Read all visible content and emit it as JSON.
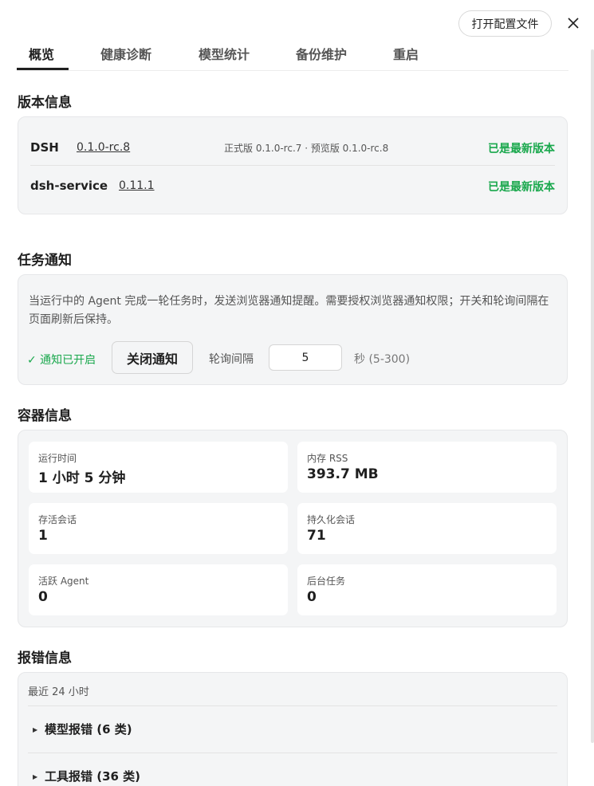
{
  "toolbar": {
    "open_config_label": "打开配置文件",
    "close_icon": "close-icon"
  },
  "tabs": [
    {
      "label": "概览",
      "active": true
    },
    {
      "label": "健康诊断",
      "active": false
    },
    {
      "label": "模型统计",
      "active": false
    },
    {
      "label": "备份维护",
      "active": false
    },
    {
      "label": "重启",
      "active": false
    }
  ],
  "version": {
    "title": "版本信息",
    "rows": [
      {
        "name": "DSH",
        "version": "0.1.0-rc.8",
        "channel": "正式版 0.1.0-rc.7 · 预览版 0.1.0-rc.8",
        "status": "已是最新版本"
      },
      {
        "name": "dsh-service",
        "version": "0.11.1",
        "channel": "",
        "status": "已是最新版本"
      }
    ]
  },
  "notify": {
    "title": "任务通知",
    "description": "当运行中的 Agent 完成一轮任务时，发送浏览器通知提醒。需要授权浏览器通知权限；开关和轮询间隔在页面刷新后保持。",
    "status": "✓ 通知已开启",
    "toggle_label": "关闭通知",
    "poll_label": "轮询间隔",
    "poll_value": "5",
    "poll_unit": "秒 (5-300)"
  },
  "container": {
    "title": "容器信息",
    "stats": [
      {
        "label": "运行时间",
        "value": "1 小时 5 分钟"
      },
      {
        "label": "内存 RSS",
        "value": "393.7 MB"
      },
      {
        "label": "存活会话",
        "value": "1"
      },
      {
        "label": "持久化会话",
        "value": "71"
      },
      {
        "label": "活跃 Agent",
        "value": "0"
      },
      {
        "label": "后台任务",
        "value": "0"
      }
    ]
  },
  "errors": {
    "title": "报错信息",
    "subtitle": "最近 24 小时",
    "groups": [
      {
        "label": "模型报错 (6 类)"
      },
      {
        "label": "工具报错 (36 类)"
      }
    ]
  },
  "colors": {
    "success": "#1aa84d",
    "card_bg": "#f4f5f6"
  }
}
